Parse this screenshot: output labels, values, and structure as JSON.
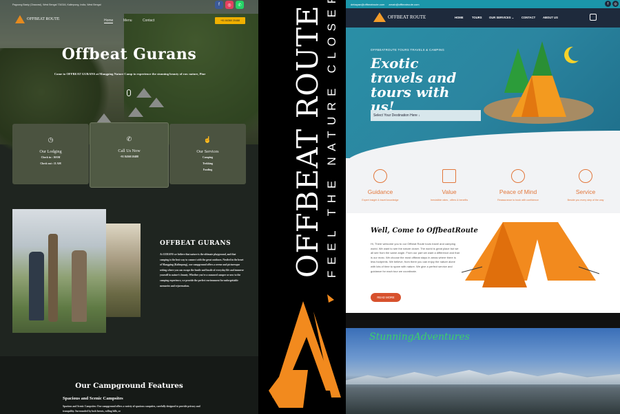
{
  "left": {
    "topbar": {
      "address": "Pagoong Basty (Chaurasi), West Bengal 734316, Kalimpong, India, West Bengal"
    },
    "nav": {
      "logo": "OFFBEAT ROUTE",
      "links": [
        "Home",
        "Menu",
        "Contact"
      ],
      "phone": "+91 84360 20488"
    },
    "hero": {
      "title": "Offbeat Gurans",
      "subtitle": "Come to OFFBEAT GURANS at Mangping Nature Camp to experience the stunning beauty of raw nature, Pine"
    },
    "cards": [
      {
        "title": "Our Lodging",
        "lines": [
          "Check in : 10AM",
          "Check out : 11 AM"
        ],
        "icon": "clock-icon"
      },
      {
        "title": "Call Us Now",
        "lines": [
          "+91 84360 20488"
        ],
        "icon": "phone-icon"
      },
      {
        "title": "Our Services",
        "lines": [
          "Camping",
          "Trekking",
          "Fooding"
        ],
        "icon": "hand-icon"
      }
    ],
    "about": {
      "heading": "OFFBEAT GURANS",
      "text": "At GURANS we believe that nature is the ultimate playground, and that camping is the best way to connect with the great outdoors. Nestled in the heart of Mangping (Kalimpong), our campground offers a serene and picturesque setting where you can escape the hustle and bustle of everyday life and immerse yourself in nature's beauty. Whether you're a seasoned camper or new to the camping experience, we provide the perfect environment for unforgettable memories and rejuvenation."
    },
    "features": {
      "heading": "Our Campground Features",
      "sub": "Spacious and Scenic Campsites",
      "text": "Spacious and Scenic Campsites: Our campground offers a variety of spacious campsites, carefully designed to provide privacy and tranquility. Surrounded by lush forests, rolling hills, or"
    }
  },
  "middle": {
    "brand": "OFFBEAT ROUTE",
    "tagline": "FEEL THE NATURE CLOSER"
  },
  "right": {
    "topbar": {
      "email1": "debayan@offbeatroute.com",
      "email2": "arnab@offbeatroute.com"
    },
    "nav": {
      "logo": "OFFBEAT ROUTE",
      "links": [
        "HOME",
        "TOURS",
        "OUR SERVICES ⌄",
        "CONTACT",
        "ABOUT US"
      ]
    },
    "hero": {
      "small": "OFFBEATROUTE TOURS TRAVELS & CAMPING",
      "title": "Exotic travels and tours with us!",
      "placeholder": "Select Your Destination Here ↓"
    },
    "services": [
      {
        "title": "Guidance",
        "sub": "Expert insight & travel knowledge"
      },
      {
        "title": "Value",
        "sub": "Irresistible rates , offers & benefits"
      },
      {
        "title": "Peace of Mind",
        "sub": "Reassurance to book with confidence"
      },
      {
        "title": "Service",
        "sub": "Beside you every step of the way"
      }
    ],
    "welcome": {
      "title": "Well, Come to OffbeatRoute",
      "text": "Hi, There welcome you to our Offbeat Route tours travel and camping world. We want to see the nature closer. The world is great place but we all see from the same angle. From our part we want a difference and that is our moto. We choose the most offbeat stays in areas where there is less footprints. We believe, from there you can enjoy the nature alone with lots of time to spare with nature. We give a perfect service and guidance for each tour we coordinate.",
      "button": "READ MORE"
    },
    "gallery": {
      "title": "StunningAdventures"
    }
  },
  "colors": {
    "accent_orange": "#f39c2a",
    "teal": "#2b85a0",
    "cta_yellow": "#f0b000"
  }
}
